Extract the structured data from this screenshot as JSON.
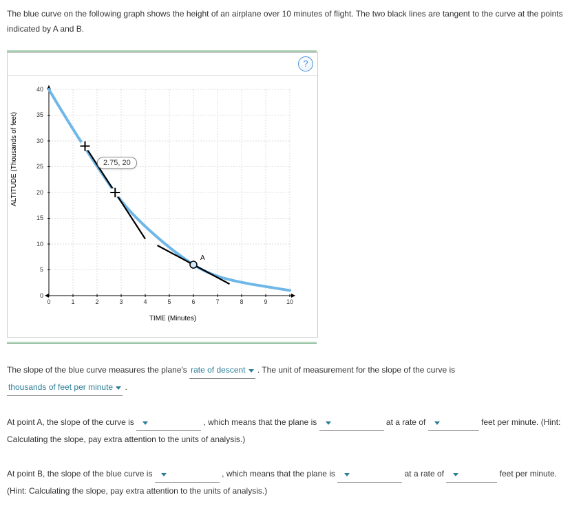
{
  "intro": "The blue curve on the following graph shows the height of an airplane over 10 minutes of flight. The two black lines are tangent to the curve at the points indicated by A and B.",
  "help_glyph": "?",
  "tooltip": "2.75, 20",
  "point_label_A": "A",
  "axis_x_label": "TIME (Minutes)",
  "axis_y_label": "ALTITUDE (Thousands of feet)",
  "x_ticks": [
    "0",
    "1",
    "2",
    "3",
    "4",
    "5",
    "6",
    "7",
    "8",
    "9",
    "10"
  ],
  "y_ticks": [
    "0",
    "5",
    "10",
    "15",
    "20",
    "25",
    "30",
    "35",
    "40"
  ],
  "q1": {
    "pre": "The slope of the blue curve measures the plane's",
    "dd1": "rate of descent",
    "mid": ". The unit of measurement for the slope of the curve is",
    "dd2": "thousands of feet per minute",
    "post": "."
  },
  "q2": {
    "pre": "At point A, the slope of the curve is",
    "mid1": ", which means that the plane is",
    "mid2": "at a rate of",
    "post": "feet per minute. (Hint: Calculating the slope, pay extra attention to the units of analysis.)"
  },
  "q3": {
    "pre": "At point B, the slope of the blue curve is",
    "mid1": ", which means that the plane is",
    "mid2": "at a rate of",
    "post": "feet per minute. (Hint: Calculating the slope, pay extra attention to the units of analysis.)"
  },
  "chart_data": {
    "type": "line",
    "xlabel": "TIME (Minutes)",
    "ylabel": "ALTITUDE (Thousands of feet)",
    "xlim": [
      0,
      10
    ],
    "ylim": [
      0,
      40
    ],
    "curve_points": [
      {
        "x": 0,
        "y": 40
      },
      {
        "x": 1,
        "y": 32
      },
      {
        "x": 2,
        "y": 25
      },
      {
        "x": 2.75,
        "y": 20
      },
      {
        "x": 4,
        "y": 13
      },
      {
        "x": 5,
        "y": 9
      },
      {
        "x": 6,
        "y": 6
      },
      {
        "x": 7,
        "y": 4
      },
      {
        "x": 8,
        "y": 2.5
      },
      {
        "x": 9,
        "y": 1.5
      },
      {
        "x": 10,
        "y": 1
      }
    ],
    "tangent_A": {
      "touch": {
        "x": 6,
        "y": 6
      },
      "p1": {
        "x": 4.5,
        "y": 9.75
      },
      "p2": {
        "x": 7.5,
        "y": 2.25
      }
    },
    "tangent_B": {
      "touch": {
        "x": 2.75,
        "y": 20
      },
      "p1": {
        "x": 1.5,
        "y": 29
      },
      "p2": {
        "x": 4,
        "y": 11
      }
    },
    "markers": [
      {
        "name": "B-cross-upper",
        "x": 1.5,
        "y": 29
      },
      {
        "name": "B-cross-lower",
        "x": 2.75,
        "y": 20
      }
    ],
    "labeled_points": [
      {
        "name": "A",
        "x": 6,
        "y": 6
      }
    ],
    "hover_tooltip": {
      "x": 2.75,
      "y": 20,
      "text": "2.75, 20"
    }
  }
}
